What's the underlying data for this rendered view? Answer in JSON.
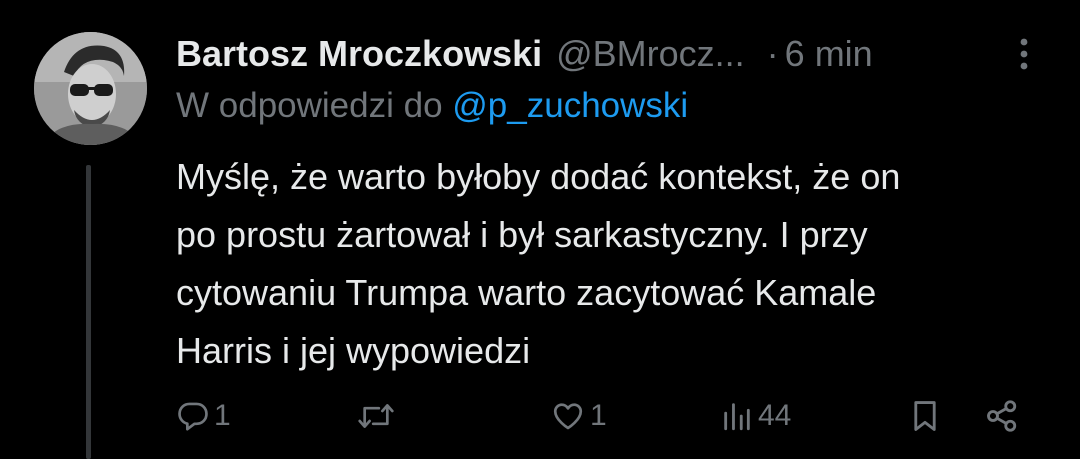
{
  "tweet": {
    "author_name": "Bartosz Mroczkowski",
    "author_handle": "@BMrocz...",
    "separator": "·",
    "timestamp": "6 min",
    "reply_prefix": "W odpowiedzi do",
    "reply_to": "@p_zuchowski",
    "text_lines": [
      "Myślę, że warto byłoby dodać kontekst, że on",
      "po prostu żartował i był sarkastyczny. I przy",
      "cytowaniu Trumpa warto zacytować Kamale",
      "Harris i jej wypowiedzi"
    ]
  },
  "actions": {
    "reply_count": "1",
    "repost_count": "",
    "like_count": "1",
    "views_count": "44"
  },
  "icons": {
    "avatar": "profile-photo",
    "more": "more-vertical-icon",
    "reply": "reply-icon",
    "repost": "repost-icon",
    "like": "heart-icon",
    "views": "analytics-icon",
    "bookmark": "bookmark-icon",
    "share": "share-icon"
  },
  "colors": {
    "background": "#000000",
    "text_primary": "#e7e9ea",
    "text_secondary": "#71767b",
    "mention": "#1d9bf0",
    "thread_line": "#333639"
  }
}
